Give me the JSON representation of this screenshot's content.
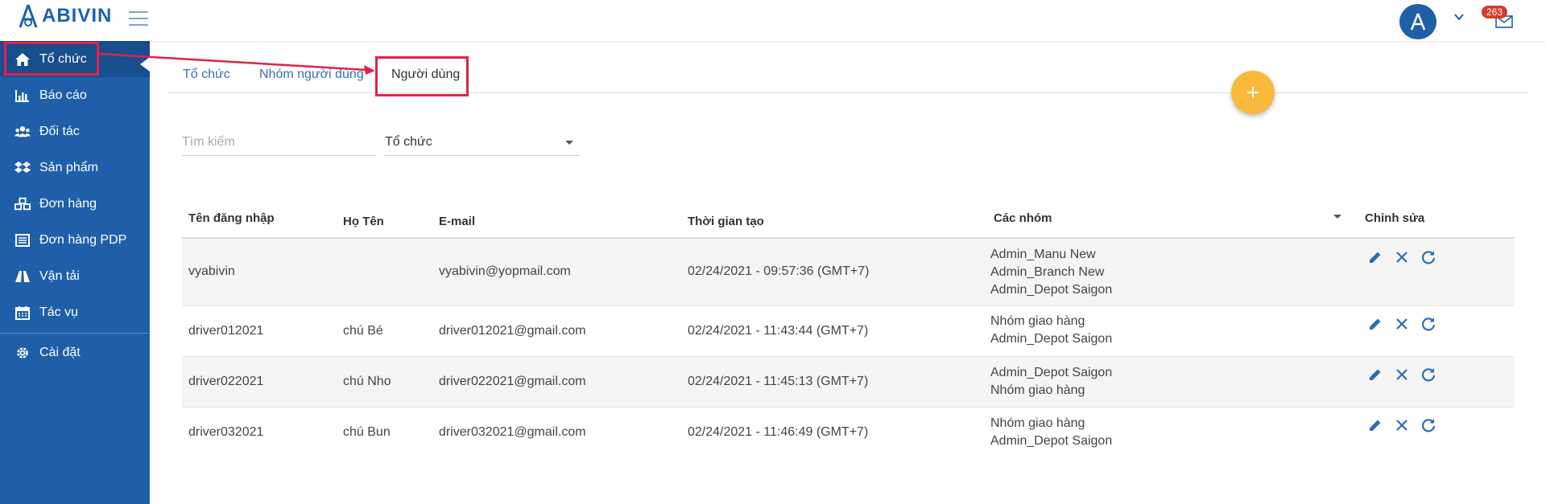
{
  "app": {
    "logo_text": "ABIVIN",
    "notification_count": "263"
  },
  "sidebar": {
    "items": [
      {
        "label": "Tổ chức",
        "icon": "home-icon"
      },
      {
        "label": "Báo cáo",
        "icon": "bar-chart-icon"
      },
      {
        "label": "Đối tác",
        "icon": "users-icon"
      },
      {
        "label": "Sản phẩm",
        "icon": "dropbox-icon"
      },
      {
        "label": "Đơn hàng",
        "icon": "cubes-icon"
      },
      {
        "label": "Đơn hàng PDP",
        "icon": "list-icon"
      },
      {
        "label": "Vận tải",
        "icon": "road-icon"
      },
      {
        "label": "Tác vụ",
        "icon": "calendar-icon"
      },
      {
        "label": "Cài đặt",
        "icon": "gear-icon"
      }
    ]
  },
  "tabs": [
    {
      "label": "Tổ chức"
    },
    {
      "label": "Nhóm người dùng"
    },
    {
      "label": "Người dùng"
    }
  ],
  "filters": {
    "search_placeholder": "Tìm kiếm",
    "org_select": "Tổ chức"
  },
  "table": {
    "headers": [
      "Tên đăng nhập",
      "Họ Tên",
      "E-mail",
      "Thời gian tạo",
      "Các nhóm",
      "Chỉnh sửa"
    ],
    "rows": [
      {
        "username": "vyabivin",
        "fullname": "",
        "email": "vyabivin@yopmail.com",
        "created": "02/24/2021 - 09:57:36 (GMT+7)",
        "groups": [
          "Admin_Manu New",
          "Admin_Branch New",
          "Admin_Depot Saigon"
        ]
      },
      {
        "username": "driver012021",
        "fullname": "chú Bé",
        "email": "driver012021@gmail.com",
        "created": "02/24/2021 - 11:43:44 (GMT+7)",
        "groups": [
          "Nhóm giao hàng",
          "Admin_Depot Saigon"
        ]
      },
      {
        "username": "driver022021",
        "fullname": "chú Nho",
        "email": "driver022021@gmail.com",
        "created": "02/24/2021 - 11:45:13 (GMT+7)",
        "groups": [
          "Admin_Depot Saigon",
          "Nhóm giao hàng"
        ]
      },
      {
        "username": "driver032021",
        "fullname": "chú Bun",
        "email": "driver032021@gmail.com",
        "created": "02/24/2021 - 11:46:49 (GMT+7)",
        "groups": [
          "Nhóm giao hàng",
          "Admin_Depot Saigon"
        ]
      }
    ]
  },
  "colors": {
    "primary": "#1f5fa9",
    "fab": "#f9b93b",
    "highlight": "#e0224a",
    "badge": "#d63a2f"
  }
}
